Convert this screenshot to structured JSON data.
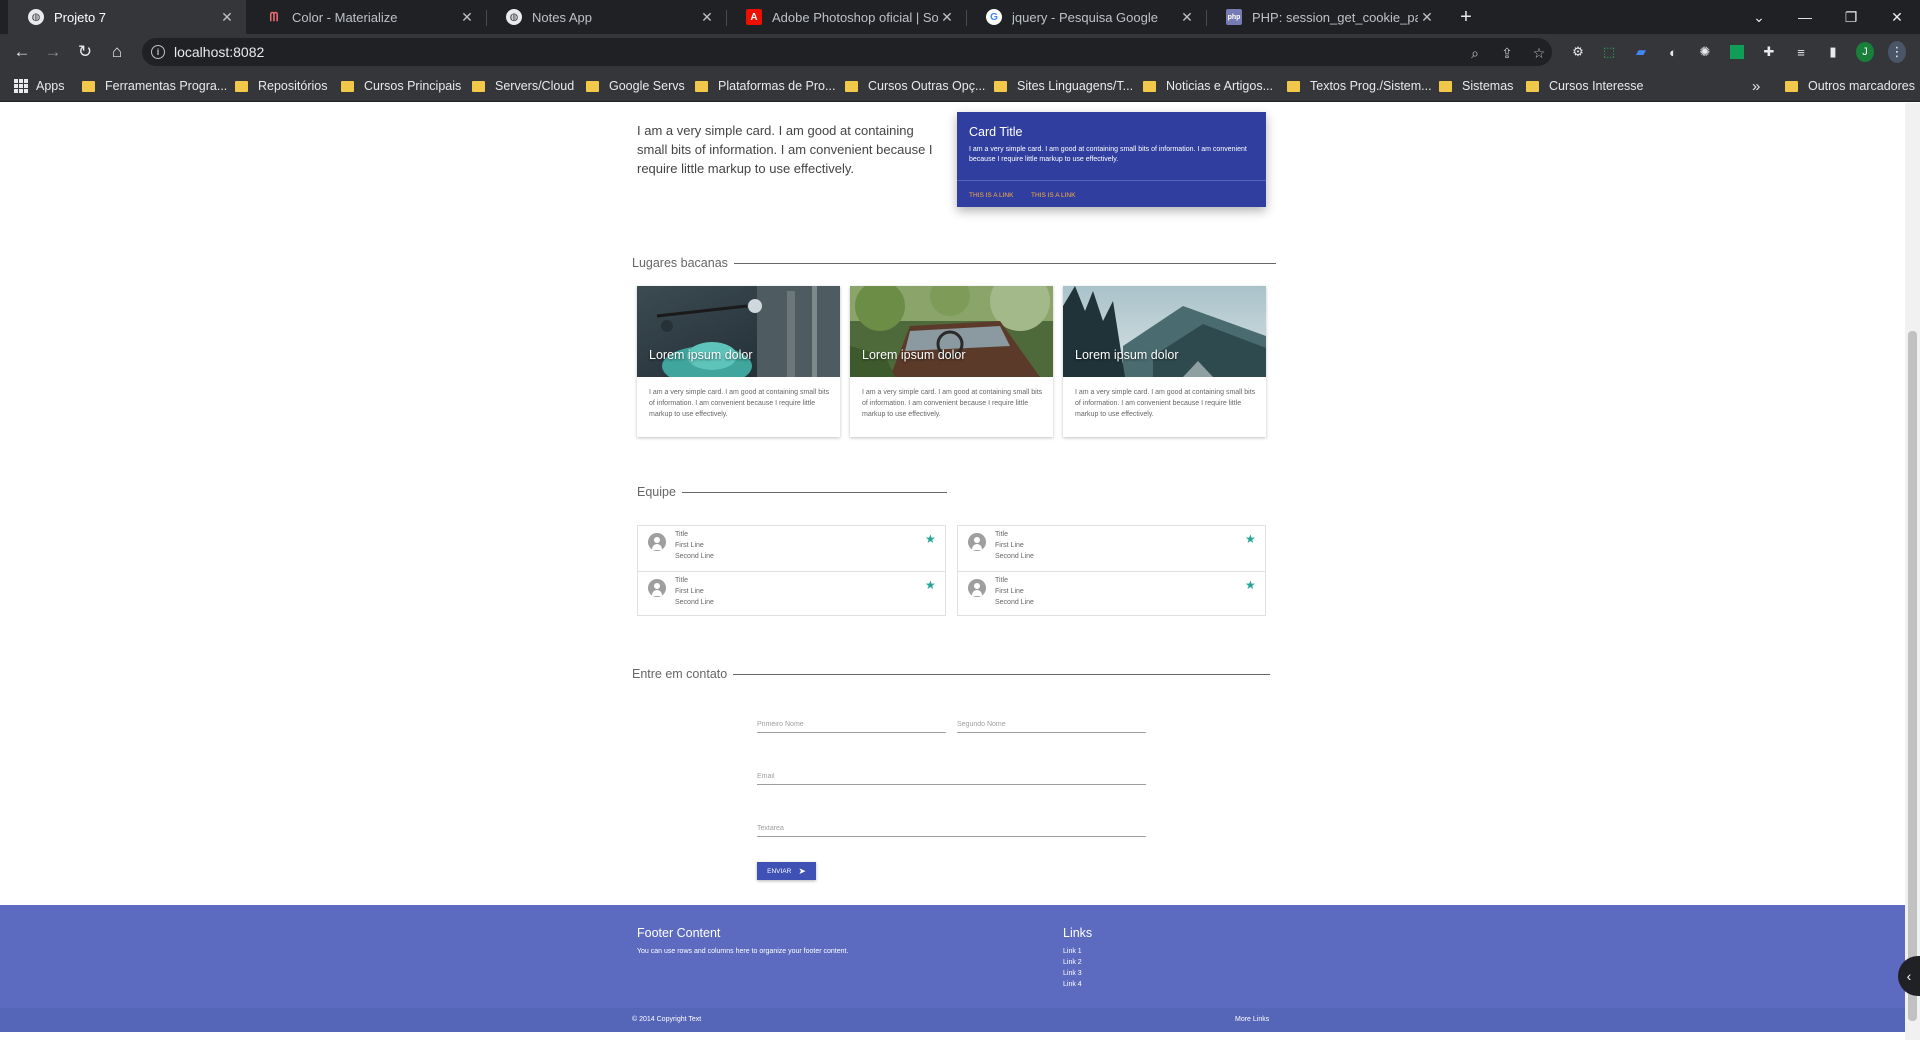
{
  "browser": {
    "tabs": [
      {
        "title": "Projeto 7",
        "active": true,
        "icon": "globe-icon"
      },
      {
        "title": "Color - Materialize",
        "active": false,
        "icon": "materialize-icon"
      },
      {
        "title": "Notes App",
        "active": false,
        "icon": "globe-icon"
      },
      {
        "title": "Adobe Photoshop oficial | Softw",
        "active": false,
        "icon": "adobe-icon"
      },
      {
        "title": "jquery - Pesquisa Google",
        "active": false,
        "icon": "google-icon"
      },
      {
        "title": "PHP: session_get_cookie_params",
        "active": false,
        "icon": "php-icon"
      }
    ],
    "url": "localhost:8082",
    "bookmarks": [
      {
        "label": "Apps",
        "type": "apps"
      },
      {
        "label": "Ferramentas Progra...",
        "type": "folder"
      },
      {
        "label": "Repositórios",
        "type": "folder"
      },
      {
        "label": "Cursos Principais",
        "type": "folder"
      },
      {
        "label": "Servers/Cloud",
        "type": "folder"
      },
      {
        "label": "Google Servs",
        "type": "folder"
      },
      {
        "label": "Plataformas de Pro...",
        "type": "folder"
      },
      {
        "label": "Cursos Outras Opç...",
        "type": "folder"
      },
      {
        "label": "Sites Linguagens/T...",
        "type": "folder"
      },
      {
        "label": "Noticias e Artigos...",
        "type": "folder"
      },
      {
        "label": "Textos Prog./Sistem...",
        "type": "folder"
      },
      {
        "label": "Sistemas",
        "type": "folder"
      },
      {
        "label": "Cursos Interesse",
        "type": "folder"
      }
    ],
    "bookmarks_overflow": "»",
    "other_bookmarks": "Outros marcadores",
    "profile_initial": "J"
  },
  "page": {
    "intro_text": "I am a very simple card. I am good at containing small bits of information. I am convenient because I require little markup to use effectively.",
    "blue_card": {
      "title": "Card Title",
      "text": "I am a very simple card. I am good at containing small bits of information. I am convenient because I require little markup to use effectively.",
      "links": [
        "This is a link",
        "This is a link"
      ],
      "color": "#303f9f",
      "link_color": "#ffab40"
    },
    "places": {
      "title": "Lugares bacanas",
      "cards": [
        {
          "title": "Lorem ipsum dolor",
          "text": "I am a very simple card. I am good at containing small bits of information. I am convenient because I require little markup to use effectively.",
          "image": "scooter-street-photo"
        },
        {
          "title": "Lorem ipsum dolor",
          "text": "I am a very simple card. I am good at containing small bits of information. I am convenient because I require little markup to use effectively.",
          "image": "old-car-forest-photo"
        },
        {
          "title": "Lorem ipsum dolor",
          "text": "I am a very simple card. I am good at containing small bits of information. I am convenient because I require little markup to use effectively.",
          "image": "mountain-forest-photo"
        }
      ]
    },
    "team": {
      "title": "Equipe",
      "items": [
        {
          "title": "Title",
          "line1": "First Line",
          "line2": "Second Line"
        },
        {
          "title": "Title",
          "line1": "First Line",
          "line2": "Second Line"
        },
        {
          "title": "Title",
          "line1": "First Line",
          "line2": "Second Line"
        },
        {
          "title": "Title",
          "line1": "First Line",
          "line2": "Second Line"
        }
      ],
      "star_color": "#26a69a"
    },
    "contact": {
      "title": "Entre em contato",
      "first_name_placeholder": "Primeiro Nome",
      "last_name_placeholder": "Segundo Nome",
      "email_placeholder": "Email",
      "textarea_placeholder": "Textarea",
      "submit_label": "Enviar"
    },
    "footer": {
      "title": "Footer Content",
      "text": "You can use rows and columns here to organize your footer content.",
      "links_title": "Links",
      "links": [
        "Link 1",
        "Link 2",
        "Link 3",
        "Link 4"
      ],
      "copyright": "© 2014 Copyright Text",
      "more_links": "More Links",
      "color": "#5c6bc0"
    }
  }
}
